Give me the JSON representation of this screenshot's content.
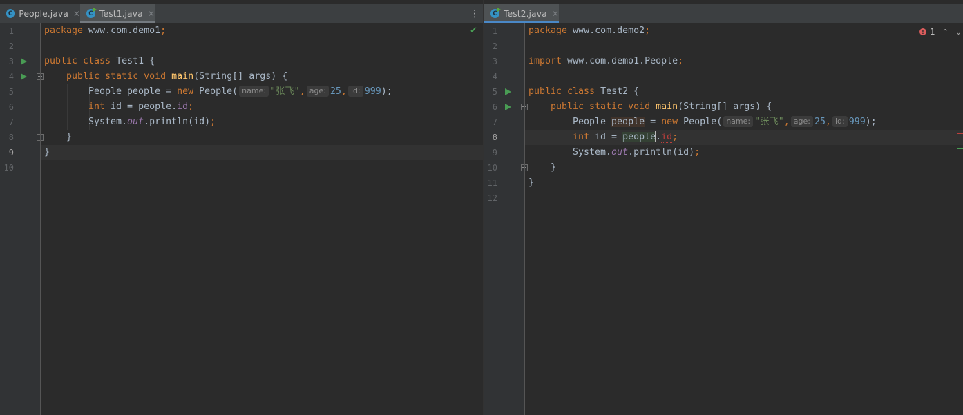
{
  "colors": {
    "keyword": "#cc7832",
    "function": "#ffc66d",
    "string": "#6a8759",
    "number": "#6897bb",
    "field": "#9876aa",
    "error": "#db5c5c",
    "tab_accent": "#4a88c7",
    "run": "#499c54"
  },
  "left_editor": {
    "tabs": [
      {
        "label": "People.java",
        "icon": "class-icon",
        "close": "✕",
        "active": false
      },
      {
        "label": "Test1.java",
        "icon": "runnable-class-icon",
        "close": "✕",
        "active": true
      }
    ],
    "tab_menu": "⋮",
    "status_icon": "check-mark-icon",
    "status_glyph": "✔",
    "line_numbers": [
      "1",
      "2",
      "3",
      "4",
      "5",
      "6",
      "7",
      "8",
      "9",
      "10"
    ],
    "code": {
      "l1_kw": "package",
      "l1_rest": " www.com.demo1",
      "l1_semi": ";",
      "l3_kw": "public class",
      "l3_rest": " Test1 {",
      "l4_kw": "public static void",
      "l4_fn": "main",
      "l4_rest": "(String[] args) {",
      "l5_type": "People people = ",
      "l5_new": "new",
      "l5_ctor": " People(",
      "l5_hint_name": "name:",
      "l5_str": "\"张飞\"",
      "l5_c1": ",",
      "l5_hint_age": "age:",
      "l5_age": "25",
      "l5_c2": ",",
      "l5_hint_id": "id:",
      "l5_id": "999",
      "l5_end": ");",
      "l6_kw": "int",
      "l6_rest": " id = people.",
      "l6_field": "id",
      "l6_semi": ";",
      "l7_a": "System.",
      "l7_out": "out",
      "l7_b": ".println(id)",
      "l7_semi": ";",
      "l8": "}",
      "l9": "}"
    }
  },
  "right_editor": {
    "tabs": [
      {
        "label": "Test2.java",
        "icon": "runnable-class-icon",
        "close": "✕",
        "active": true
      }
    ],
    "inspection": {
      "count": "1",
      "up": "⌃",
      "down": "⌄"
    },
    "line_numbers": [
      "1",
      "2",
      "3",
      "4",
      "5",
      "6",
      "7",
      "8",
      "9",
      "10",
      "11",
      "12"
    ],
    "code": {
      "l1_kw": "package",
      "l1_rest": " www.com.demo2",
      "l1_semi": ";",
      "l3_kw": "import",
      "l3_rest": " www.com.demo1.People",
      "l3_semi": ";",
      "l5_kw": "public class",
      "l5_rest": " Test2 {",
      "l6_kw": "public static void",
      "l6_fn": "main",
      "l6_rest": "(String[] args) {",
      "l7_type": "People ",
      "l7_var": "people",
      "l7_eq": " = ",
      "l7_new": "new",
      "l7_ctor": " People(",
      "l7_hint_name": "name:",
      "l7_str": "\"张飞\"",
      "l7_c1": ",",
      "l7_hint_age": "age:",
      "l7_age": "25",
      "l7_c2": ",",
      "l7_hint_id": "id:",
      "l7_id": "999",
      "l7_end": ");",
      "l8_kw": "int",
      "l8_rest": " id = ",
      "l8_var_a": "people",
      "l8_dot": ".",
      "l8_field": "id",
      "l8_semi": ";",
      "l9_a": "System.",
      "l9_out": "out",
      "l9_b": ".println(id)",
      "l9_semi": ";",
      "l10": "}",
      "l11": "}"
    }
  }
}
